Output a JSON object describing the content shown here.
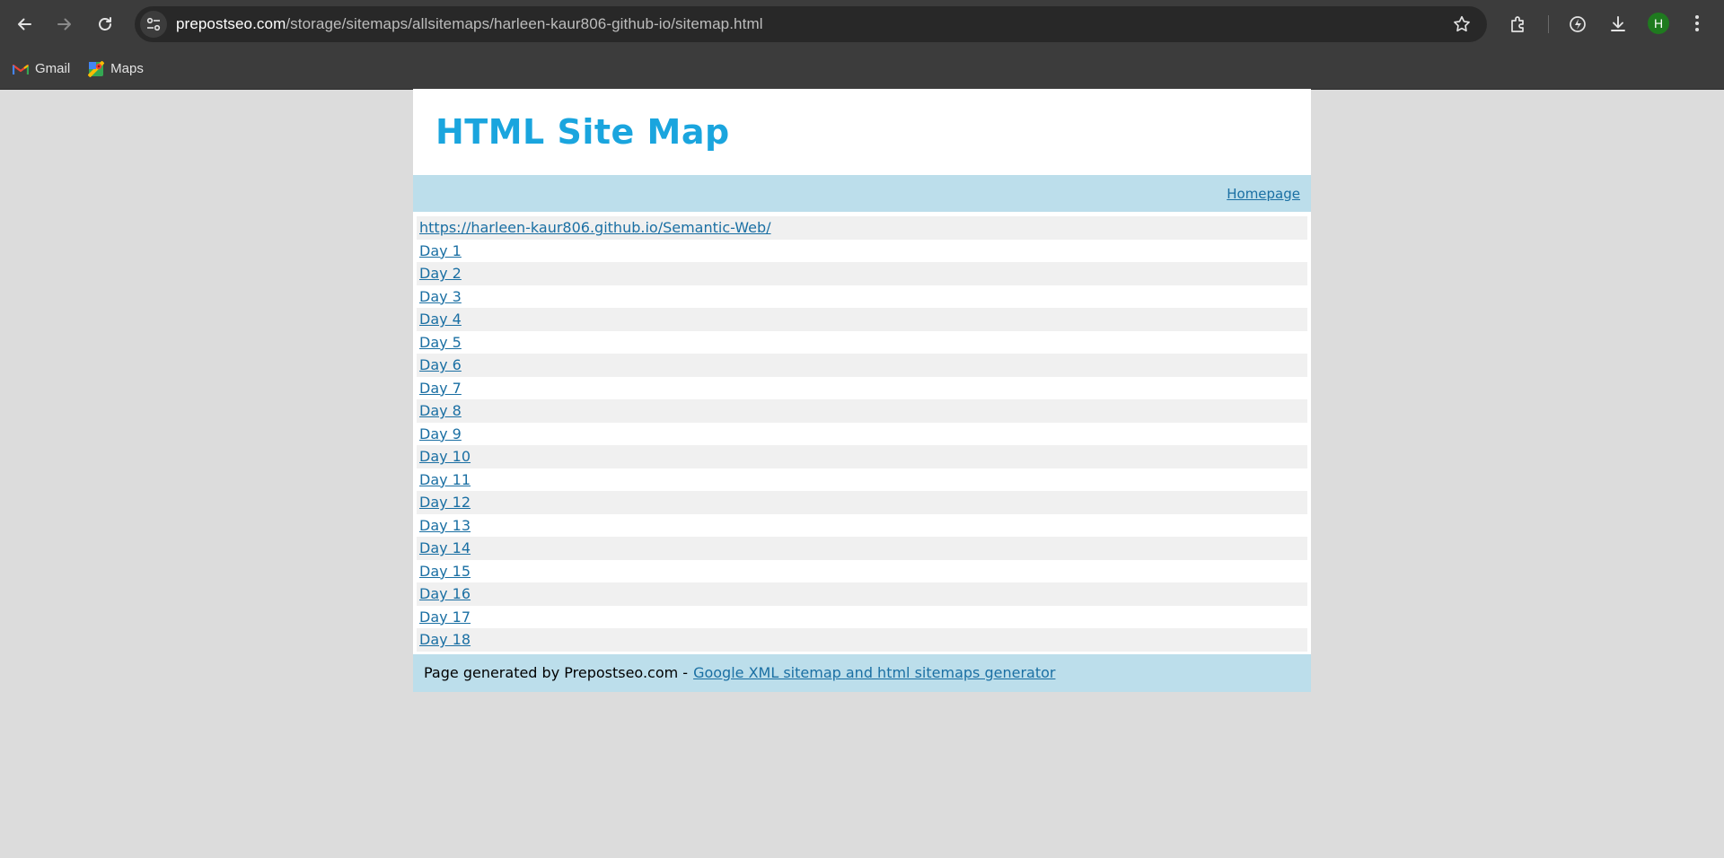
{
  "browser": {
    "url_host": "prepostseo.com",
    "url_path": "/storage/sitemaps/allsitemaps/harleen-kaur806-github-io/sitemap.html",
    "profile_initial": "H",
    "bookmarks": [
      {
        "label": "Gmail",
        "icon": "gmail-icon"
      },
      {
        "label": "Maps",
        "icon": "maps-icon"
      }
    ]
  },
  "page": {
    "title": "HTML Site Map",
    "homepage_link": "Homepage",
    "links": [
      "https://harleen-kaur806.github.io/Semantic-Web/",
      "Day 1",
      "Day 2",
      "Day 3",
      "Day 4",
      "Day 5",
      "Day 6",
      "Day 7",
      "Day 8",
      "Day 9",
      "Day 10",
      "Day 11",
      "Day 12",
      "Day 13",
      "Day 14",
      "Day 15",
      "Day 16",
      "Day 17",
      "Day 18"
    ],
    "footer_text": "Page generated by Prepostseo.com -",
    "footer_link": "Google XML sitemap and html sitemaps generator"
  },
  "colors": {
    "heading": "#1aa5de",
    "link": "#1a6fa3",
    "bar": "#bcdeeb",
    "page_bg": "#dcdcdc"
  }
}
